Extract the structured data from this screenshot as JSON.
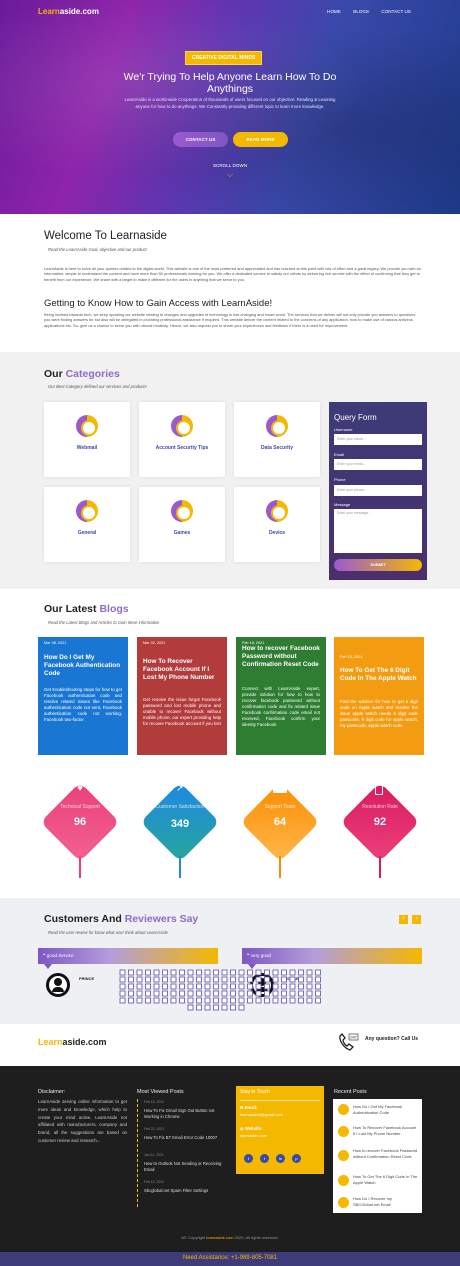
{
  "nav": {
    "logo_a": "Learn",
    "logo_b": "aside.com",
    "items": [
      "HOME",
      "BLOGS",
      "CONTACT US"
    ]
  },
  "hero": {
    "badge": "CREATIVE DIGITAL MINDS",
    "title": "We'r Trying To Help Anyone Learn How To Do Anythings",
    "text": "LearnAside is a world-wide Cooperation of thousands of users focused on our objective: Reading & Learning anyone for how to do anythings. We Constantly providing different topic to learn more knowledge.",
    "btn_contact": "CONTACT US",
    "btn_read": "READ MORE",
    "scroll": "SCROLL DOWN"
  },
  "welcome": {
    "title": "Welcome To Learnaside",
    "sub": "Read the LearnAside Goal, objective and our product",
    "p1": "LearnAside is here to solve all your queries related to the digital world. This website is one of the most preferred and appreciated and has reached at this point with lots of effort and a great legacy. We provide you with an information, simple to understand the content and have more than 50 professionals working for you. We offer a dedicated service to satisfy our clients by delivering rich service with the effect of confirming that they get to benefit from our experience. We share with a target to make it different for the users in anything that we serve to you.",
    "h2": "Getting to Know How to Gain Access with LearnAside!",
    "p2": "Being inclined towards tech, we keep updating our website relating to changes and upgrades of technology in this changing and smart world. The services that we deliver will not only provide you answers to questions you were finding answers for but also will be delegated in providing professional assistance if required. This website deliver the content related to the concerns of any application, how to make use of various antivirus applications etc. So- give us a chance to serve you with utmost modesty. Hence, we also request you to share your experiences and feedback if there is a need for improvement."
  },
  "categories": {
    "title_a": "Our ",
    "title_b": "Categories",
    "sub": "Our Best Category defined our services and products",
    "items": [
      "Webmail",
      "Account Security Tips",
      "Data Security",
      "General",
      "Games",
      "Device"
    ]
  },
  "query": {
    "title": "Query Form",
    "l_user": "Username",
    "p_user": "Enter your name...",
    "l_email": "Email",
    "p_email": "Enter your email...",
    "l_phone": "Phone",
    "p_phone": "Enter your phone...",
    "l_msg": "Message",
    "p_msg": "Enter your message...",
    "submit": "SUBMIT"
  },
  "blogs": {
    "title_a": "Our Latest ",
    "title_b": "Blogs",
    "sub": "Read the Latest Blogs and Articles to Gain More information",
    "items": [
      {
        "date": "Mar 08, 2021",
        "title": "How Do I Get My Facebook Authentication Code",
        "body": "Get troubleshooting steps for how to get Facebook authentication code and resolve related issues like Facebook authentication code not sent, Facebook authentication code not working, Facebook two-factor",
        "color": "#1976d2"
      },
      {
        "date": "Mar 02, 2021",
        "title": "How To Recover Facebook Account If I Lost My Phone Number",
        "body": "Get resolve the issue forgot Facebook password and lost mobile phone and unable to recover Facebook without mobile phone, our expert providing help for recover Facebook account if you lost",
        "color": "#b23b3b"
      },
      {
        "date": "Feb 18, 2021",
        "title": "How to recover Facebook Password without Confirmation Reset Code",
        "body": "Connect with LearnAside expert, provide solution for how to how to recover facebook password without confirmation code and fix related issue Facebook confirmation code email not received, Facebook confirm your identity Facebook",
        "color": "#2e7d32"
      },
      {
        "date": "Feb 13, 2021",
        "title": "How To Get The 6 Digit Code In The Apple Watch",
        "body": "Find the solution for how to get 6 digit code on Apple watch and resolve the issue apple watch needs 6 digit code passcode, 6 digit code for apple watch, my passcode, apple watch code",
        "color": "#f39c12"
      }
    ]
  },
  "stats": [
    {
      "label": "Technical Support",
      "value": "96",
      "color": "#ec407a"
    },
    {
      "label": "Customer Satisfaction",
      "value": "349",
      "color": "#1e88e5"
    },
    {
      "label": "Support Team",
      "value": "64",
      "color": "#fb8c00"
    },
    {
      "label": "Resolution Rate",
      "value": "92",
      "color": "#d81b60"
    }
  ],
  "reviews": {
    "title_a": "Customers And ",
    "title_b": "Reviewers Say",
    "sub": "Read the user review for know what user think about LearnAside",
    "r1_text": "good Service",
    "r1_name": "PRINCE",
    "r2_text": "very good",
    "r2_name": "MICHAEL"
  },
  "cta": {
    "logo_a": "Learn",
    "logo_b": "aside.com",
    "question": "Any question? Call Us",
    "phone_label": "24/7"
  },
  "footer": {
    "disclaimer_h": "Disclaimer:",
    "disclaimer": "LearnAside serving online information to get more ideas and knowledge, which help to create your mind active. LearnAside not affiliated with manufacturers, company and brand, all the suggestions are based on customer review and research...",
    "most_h": "Most Viewed Posts",
    "most": [
      {
        "date": "Feb 15, 2021",
        "title": "How To Fix Gmail Sign Out Button not Working in Chrome"
      },
      {
        "date": "Feb 22, 2021",
        "title": "How To Fix BT Email Error Code 10007"
      },
      {
        "date": "Jan 21, 2021",
        "title": "How to Outlook Not Sending or Receiving Email"
      },
      {
        "date": "Feb 12, 2021",
        "title": "Sbcglobal.net Spam Filter Settings"
      }
    ],
    "touch_h": "Stay in Touch",
    "email_l": "Email:",
    "email": "learnaside8@gmail.com",
    "web_l": "Website:",
    "web": "learnaside.com",
    "recent_h": "Recent Posts",
    "recent": [
      "How Do I Get My Facebook Authentication Code",
      "How To Recover Facebook Account If I Lost My Phone Number",
      "How to recover Facebook Password without Confirmation Reset Code",
      "How To Get The 6 Digit Code In The Apple Watch",
      "How Do I Recover my SBCGlobal.net Email"
    ],
    "copy_a": "A© Copyright ",
    "copy_b": "learnaside.com",
    "copy_c": " 2020, All rights reserved.",
    "assist": "Need Assistance: +1-989-805-7081"
  }
}
